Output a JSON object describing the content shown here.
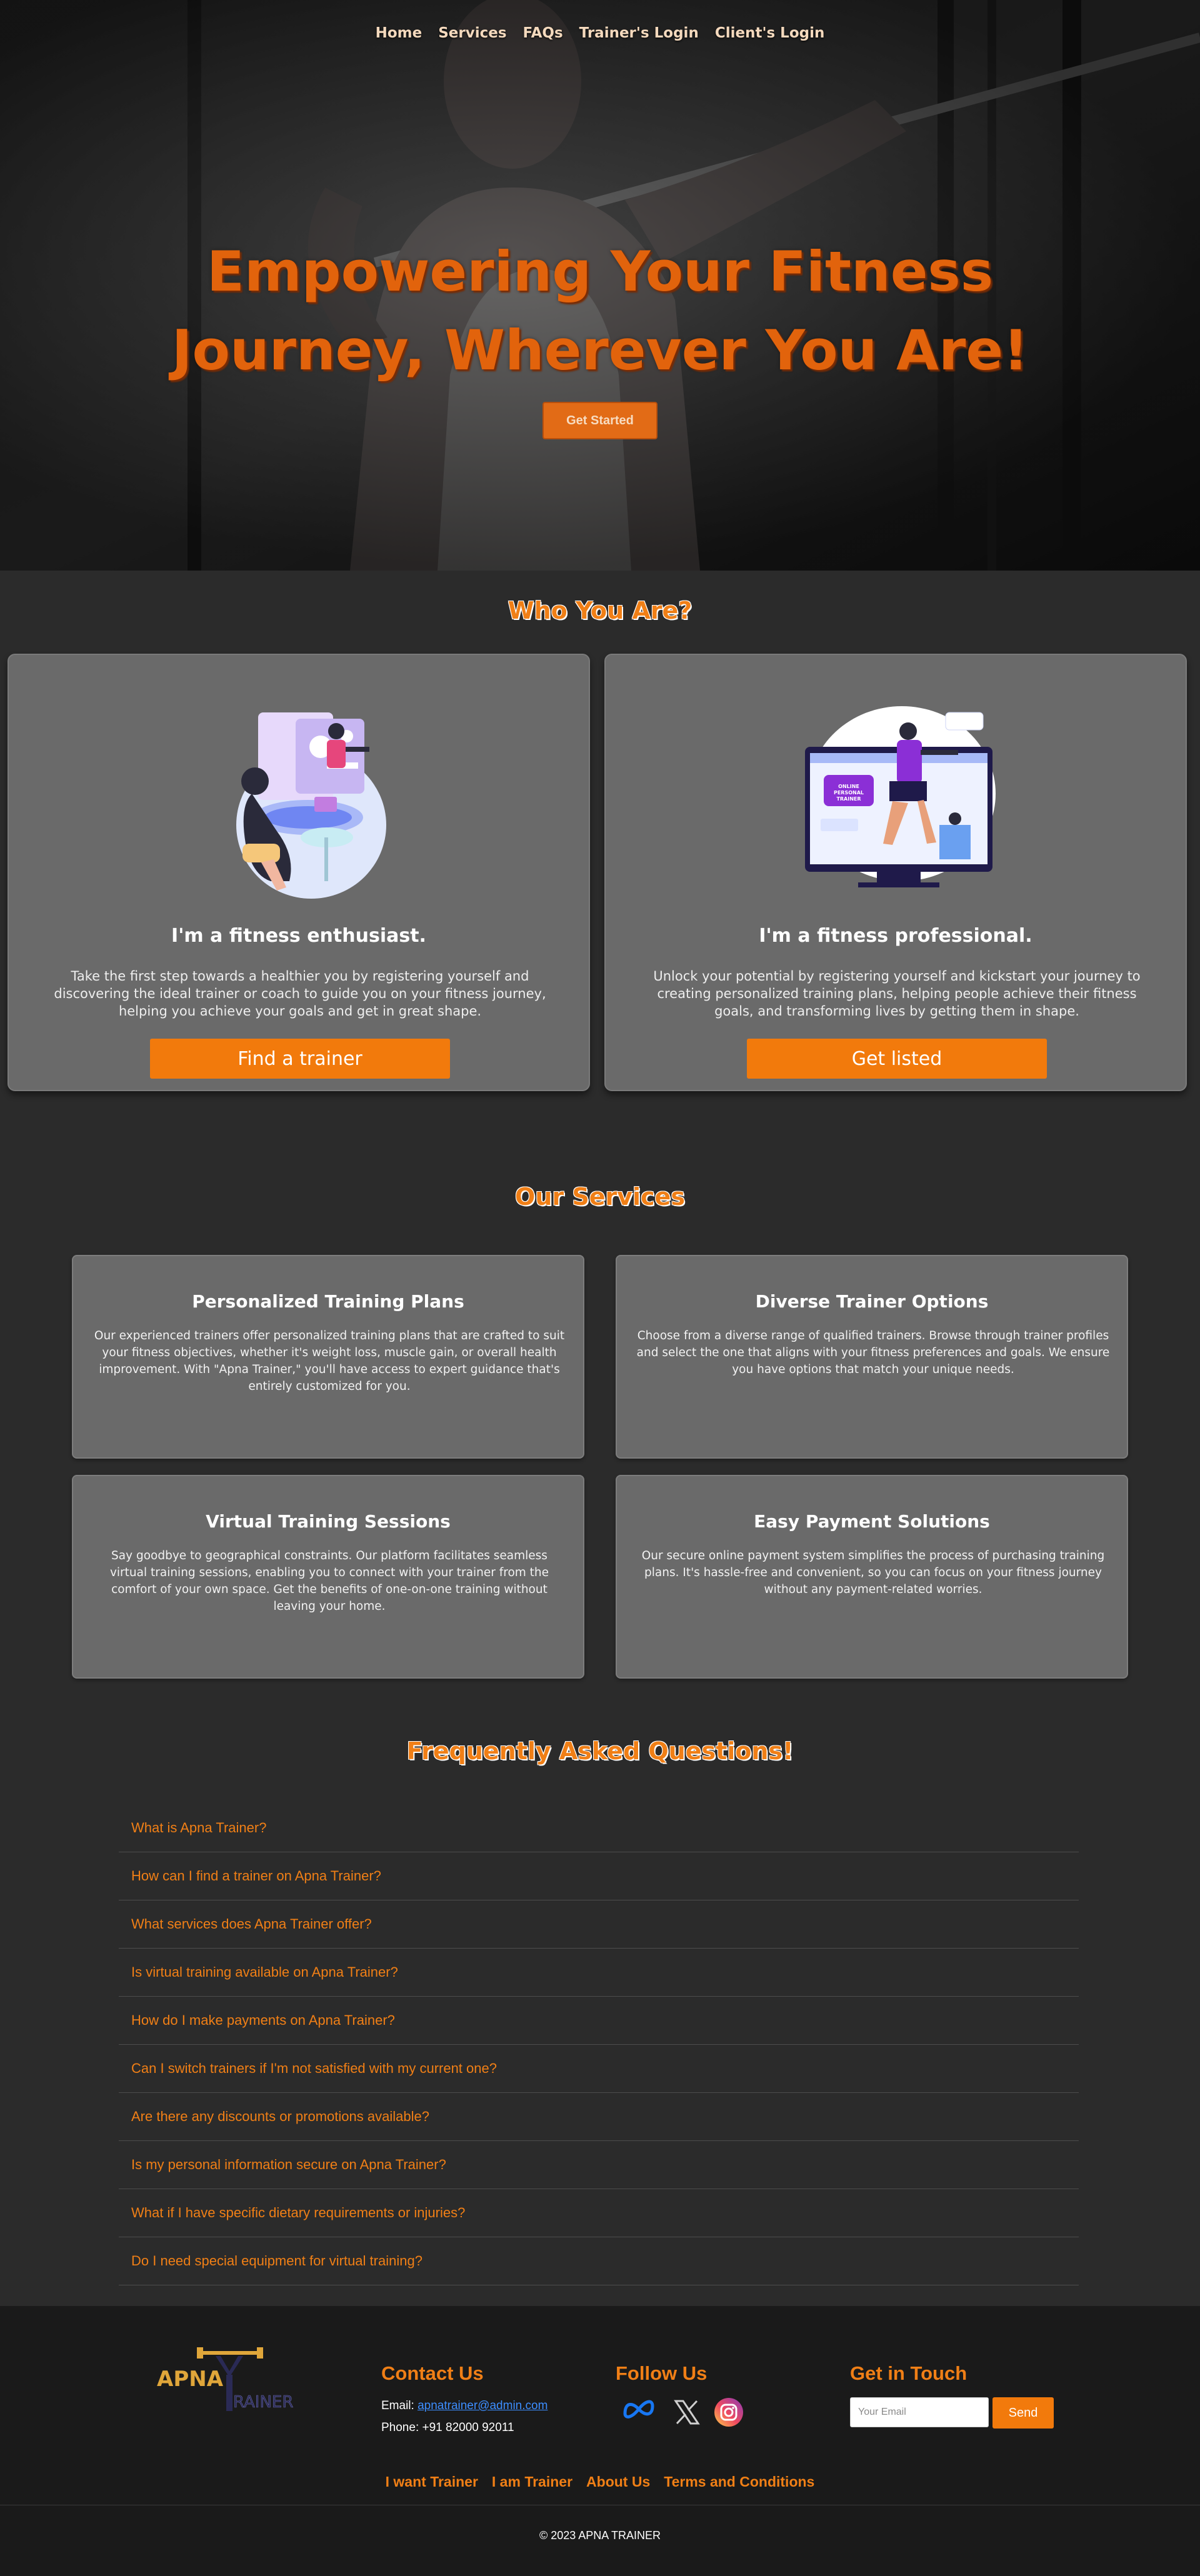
{
  "nav": {
    "items": [
      "Home",
      "Services",
      "FAQs",
      "Trainer's Login",
      "Client's Login"
    ]
  },
  "hero": {
    "title_line1": "Empowering Your Fitness",
    "title_line2": "Journey, Wherever You Are!",
    "cta_label": "Get Started"
  },
  "who": {
    "title": "Who You Are?",
    "cards": [
      {
        "heading": "I'm a fitness enthusiast.",
        "text": "Take the first step towards a healthier you by registering yourself and discovering the ideal trainer or coach to guide you on your fitness journey, helping you achieve your goals and get in great shape.",
        "button": "Find a trainer",
        "illustration": "fitness-enthusiast-illustration"
      },
      {
        "heading": "I'm a fitness professional.",
        "text": "Unlock your potential by registering yourself and kickstart your journey to creating personalized training plans, helping people achieve their fitness goals, and transforming lives by getting them in shape.",
        "button": "Get listed",
        "illustration": "online-personal-trainer-illustration",
        "illustration_badge": "ONLINE PERSONAL TRAINER"
      }
    ]
  },
  "services": {
    "title": "Our Services",
    "cards": [
      {
        "heading": "Personalized Training Plans",
        "text": "Our experienced trainers offer personalized training plans that are crafted to suit your fitness objectives, whether it's weight loss, muscle gain, or overall health improvement. With \"Apna Trainer,\" you'll have access to expert guidance that's entirely customized for you."
      },
      {
        "heading": "Diverse Trainer Options",
        "text": "Choose from a diverse range of qualified trainers. Browse through trainer profiles and select the one that aligns with your fitness preferences and goals. We ensure you have options that match your unique needs."
      },
      {
        "heading": "Virtual Training Sessions",
        "text": "Say goodbye to geographical constraints. Our platform facilitates seamless virtual training sessions, enabling you to connect with your trainer from the comfort of your own space. Get the benefits of one-on-one training without leaving your home."
      },
      {
        "heading": "Easy Payment Solutions",
        "text": "Our secure online payment system simplifies the process of purchasing training plans. It's hassle-free and convenient, so you can focus on your fitness journey without any payment-related worries."
      }
    ]
  },
  "faq": {
    "title": "Frequently Asked Questions!",
    "questions": [
      "What is Apna Trainer?",
      "How can I find a trainer on Apna Trainer?",
      "What services does Apna Trainer offer?",
      "Is virtual training available on Apna Trainer?",
      "How do I make payments on Apna Trainer?",
      "Can I switch trainers if I'm not satisfied with my current one?",
      "Are there any discounts or promotions available?",
      "Is my personal information secure on Apna Trainer?",
      "What if I have specific dietary requirements or injuries?",
      "Do I need special equipment for virtual training?"
    ]
  },
  "footer": {
    "logo_text": "APNA TRAINER",
    "contact": {
      "title": "Contact Us",
      "email_label": "Email: ",
      "email": "apnatrainer@admin.com",
      "phone": "Phone: +91 82000 92011"
    },
    "follow": {
      "title": "Follow Us",
      "icons": [
        "meta-icon",
        "x-icon",
        "instagram-icon"
      ]
    },
    "touch": {
      "title": "Get in Touch",
      "email_placeholder": "Your Email",
      "send_label": "Send"
    },
    "links": [
      "I want Trainer",
      "I am Trainer",
      "About Us",
      "Terms and Conditions"
    ],
    "copyright": "© 2023 APNA TRAINER"
  },
  "colors": {
    "accent": "#f07f16",
    "button": "#f27a0c",
    "background": "#2b2b2b",
    "card": "#6a6a6a",
    "footer": "#1a1a1a"
  }
}
